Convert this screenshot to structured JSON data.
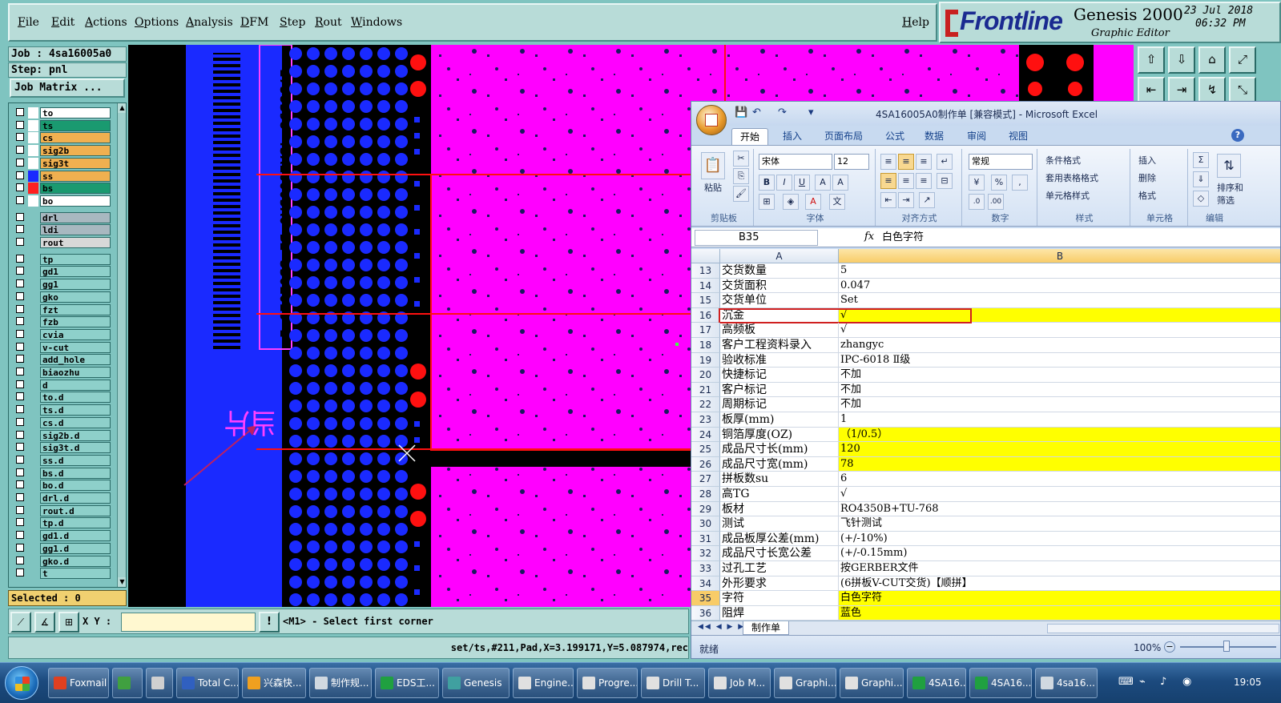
{
  "genesis": {
    "menu": [
      "File",
      "Edit",
      "Actions",
      "Options",
      "Analysis",
      "DFM",
      "Step",
      "Rout",
      "Windows"
    ],
    "help": "Help",
    "brand": "Frontline",
    "product": "Genesis 2000",
    "subtitle": "Graphic Editor",
    "date": "23 Jul 2018",
    "time": "06:32 PM",
    "job": "Job : 4sa16005a0",
    "step": "Step: pnl",
    "job_matrix": "Job Matrix ...",
    "layers": [
      {
        "name": "to",
        "color": "#ffffff",
        "bg": "#ffffff"
      },
      {
        "name": "ts",
        "color": "#ffffff",
        "bg": "#1a9a70"
      },
      {
        "name": "cs",
        "color": "#ffffff",
        "bg": "#f0b050"
      },
      {
        "name": "sig2b",
        "color": "#ffffff",
        "bg": "#f0b050"
      },
      {
        "name": "sig3t",
        "color": "#ffffff",
        "bg": "#f0b050"
      },
      {
        "name": "ss",
        "color": "#1a2aff",
        "bg": "#f0b050"
      },
      {
        "name": "bs",
        "color": "#ff2020",
        "bg": "#1a9a70"
      },
      {
        "name": "bo",
        "color": "#ffffff",
        "bg": "#ffffff"
      },
      {
        "name": "drl",
        "color": "#7fc4c0",
        "bg": "#a8b8c0"
      },
      {
        "name": "ldi",
        "color": "#7fc4c0",
        "bg": "#a8b8c0"
      },
      {
        "name": "rout",
        "color": "#7fc4c0",
        "bg": "#d8d8d8"
      },
      {
        "name": "tp",
        "color": "#7fc4c0",
        "bg": "#8ed0ca"
      },
      {
        "name": "gd1",
        "color": "#7fc4c0",
        "bg": "#8ed0ca"
      },
      {
        "name": "gg1",
        "color": "#7fc4c0",
        "bg": "#8ed0ca"
      },
      {
        "name": "gko",
        "color": "#7fc4c0",
        "bg": "#8ed0ca"
      },
      {
        "name": "fzt",
        "color": "#7fc4c0",
        "bg": "#8ed0ca"
      },
      {
        "name": "fzb",
        "color": "#7fc4c0",
        "bg": "#8ed0ca"
      },
      {
        "name": "cvia",
        "color": "#7fc4c0",
        "bg": "#8ed0ca"
      },
      {
        "name": "v-cut",
        "color": "#7fc4c0",
        "bg": "#8ed0ca"
      },
      {
        "name": "add_hole",
        "color": "#7fc4c0",
        "bg": "#8ed0ca"
      },
      {
        "name": "biaozhu",
        "color": "#7fc4c0",
        "bg": "#8ed0ca"
      },
      {
        "name": "d",
        "color": "#7fc4c0",
        "bg": "#8ed0ca"
      },
      {
        "name": "to.d",
        "color": "#7fc4c0",
        "bg": "#8ed0ca"
      },
      {
        "name": "ts.d",
        "color": "#7fc4c0",
        "bg": "#8ed0ca"
      },
      {
        "name": "cs.d",
        "color": "#7fc4c0",
        "bg": "#8ed0ca"
      },
      {
        "name": "sig2b.d",
        "color": "#7fc4c0",
        "bg": "#8ed0ca"
      },
      {
        "name": "sig3t.d",
        "color": "#7fc4c0",
        "bg": "#8ed0ca"
      },
      {
        "name": "ss.d",
        "color": "#7fc4c0",
        "bg": "#8ed0ca"
      },
      {
        "name": "bs.d",
        "color": "#7fc4c0",
        "bg": "#8ed0ca"
      },
      {
        "name": "bo.d",
        "color": "#7fc4c0",
        "bg": "#8ed0ca"
      },
      {
        "name": "drl.d",
        "color": "#7fc4c0",
        "bg": "#8ed0ca"
      },
      {
        "name": "rout.d",
        "color": "#7fc4c0",
        "bg": "#8ed0ca"
      },
      {
        "name": "tp.d",
        "color": "#7fc4c0",
        "bg": "#8ed0ca"
      },
      {
        "name": "gd1.d",
        "color": "#7fc4c0",
        "bg": "#8ed0ca"
      },
      {
        "name": "gg1.d",
        "color": "#7fc4c0",
        "bg": "#8ed0ca"
      },
      {
        "name": "gko.d",
        "color": "#7fc4c0",
        "bg": "#8ed0ca"
      },
      {
        "name": "t",
        "color": "#7fc4c0",
        "bg": "#8ed0ca"
      }
    ],
    "selected": "Selected : 0",
    "xy_label": "X Y :",
    "xy_value": "",
    "alert": "!",
    "prompt": "<M1> - Select first corner",
    "status": "set/ts,#211,Pad,X=3.199171,Y=5.087974,rec"
  },
  "excel": {
    "title": "4SA16005A0制作单  [兼容模式] - Microsoft Excel",
    "tabs": [
      "开始",
      "插入",
      "页面布局",
      "公式",
      "数据",
      "审阅",
      "视图"
    ],
    "active_tab": "开始",
    "ribbon": {
      "paste": "粘贴",
      "clipboard": "剪贴板",
      "font_name": "宋体",
      "font_size": "12",
      "font": "字体",
      "alignment": "对齐方式",
      "number_format": "常规",
      "number": "数字",
      "cond_format": "条件格式",
      "table_format": "套用表格格式",
      "cell_style": "单元格样式",
      "styles": "样式",
      "insert": "插入",
      "delete": "删除",
      "format": "格式",
      "cells": "单元格",
      "sort_filter": "排序和",
      "filter": "筛选",
      "editing": "编辑"
    },
    "name_box": "B35",
    "fx": "fx",
    "formula": "白色字符",
    "col_a": "A",
    "col_b": "B",
    "rows": [
      {
        "num": "13",
        "a": "交货数量",
        "b": "5",
        "yellow": false
      },
      {
        "num": "14",
        "a": "交货面积",
        "b": "0.047",
        "yellow": false
      },
      {
        "num": "15",
        "a": "交货单位",
        "b": "Set",
        "yellow": false
      },
      {
        "num": "16",
        "a": "沉金",
        "b": "√",
        "yellow": true
      },
      {
        "num": "17",
        "a": "高频板",
        "b": "√",
        "yellow": false
      },
      {
        "num": "18",
        "a": "客户工程资料录入",
        "b": "zhangyc",
        "yellow": false
      },
      {
        "num": "19",
        "a": "验收标准",
        "b": "IPC-6018 Ⅱ级",
        "yellow": false
      },
      {
        "num": "20",
        "a": "快捷标记",
        "b": "不加",
        "yellow": false
      },
      {
        "num": "21",
        "a": "客户标记",
        "b": "不加",
        "yellow": false
      },
      {
        "num": "22",
        "a": "周期标记",
        "b": "不加",
        "yellow": false
      },
      {
        "num": "23",
        "a": "板厚(mm)",
        "b": "1",
        "yellow": false
      },
      {
        "num": "24",
        "a": "铜箔厚度(OZ)",
        "b": "（1/0.5）",
        "yellow": true
      },
      {
        "num": "25",
        "a": "成品尺寸长(mm)",
        "b": "120",
        "yellow": true
      },
      {
        "num": "26",
        "a": "成品尺寸宽(mm)",
        "b": "78",
        "yellow": true
      },
      {
        "num": "27",
        "a": "拼板数su",
        "b": "6",
        "yellow": false
      },
      {
        "num": "28",
        "a": "高TG",
        "b": "√",
        "yellow": false
      },
      {
        "num": "29",
        "a": "板材",
        "b": "RO4350B+TU-768",
        "yellow": false
      },
      {
        "num": "30",
        "a": "测试",
        "b": "飞针测试",
        "yellow": false
      },
      {
        "num": "31",
        "a": "成品板厚公差(mm)",
        "b": "(+/-10%)",
        "yellow": false
      },
      {
        "num": "32",
        "a": "成品尺寸长宽公差",
        "b": "(+/-0.15mm)",
        "yellow": false
      },
      {
        "num": "33",
        "a": "过孔工艺",
        "b": "按GERBER文件",
        "yellow": false
      },
      {
        "num": "34",
        "a": "外形要求",
        "b": "(6拼板V-CUT交货)【顺拼】",
        "yellow": false
      },
      {
        "num": "35",
        "a": "字符",
        "b": "白色字符",
        "yellow": true
      },
      {
        "num": "36",
        "a": "阻焊",
        "b": "蓝色",
        "yellow": true
      }
    ],
    "sheet_tab": "制作单",
    "status_ready": "就绪",
    "zoom": "100%"
  },
  "taskbar": {
    "items": [
      {
        "label": "Foxmail",
        "color": "#e04020"
      },
      {
        "label": "",
        "color": "#40a040"
      },
      {
        "label": "",
        "color": "#d0d0d0"
      },
      {
        "label": "Total C...",
        "color": "#3060c0"
      },
      {
        "label": "兴森快...",
        "color": "#f0a020"
      },
      {
        "label": "制作规...",
        "color": "#d0d8e0"
      },
      {
        "label": "EDS工...",
        "color": "#20a040"
      },
      {
        "label": "Genesis",
        "color": "#40a0a0"
      },
      {
        "label": "Engine...",
        "color": "#e0e0e0"
      },
      {
        "label": "Progre...",
        "color": "#e0e0e0"
      },
      {
        "label": "Drill T...",
        "color": "#e0e0e0"
      },
      {
        "label": "Job M...",
        "color": "#e0e0e0"
      },
      {
        "label": "Graphi...",
        "color": "#e0e0e0"
      },
      {
        "label": "Graphi...",
        "color": "#e0e0e0"
      },
      {
        "label": "4SA16...",
        "color": "#20a040"
      },
      {
        "label": "4SA16...",
        "color": "#20a040"
      },
      {
        "label": "4sa16...",
        "color": "#d0d8e0"
      }
    ],
    "clock": "19:05"
  }
}
